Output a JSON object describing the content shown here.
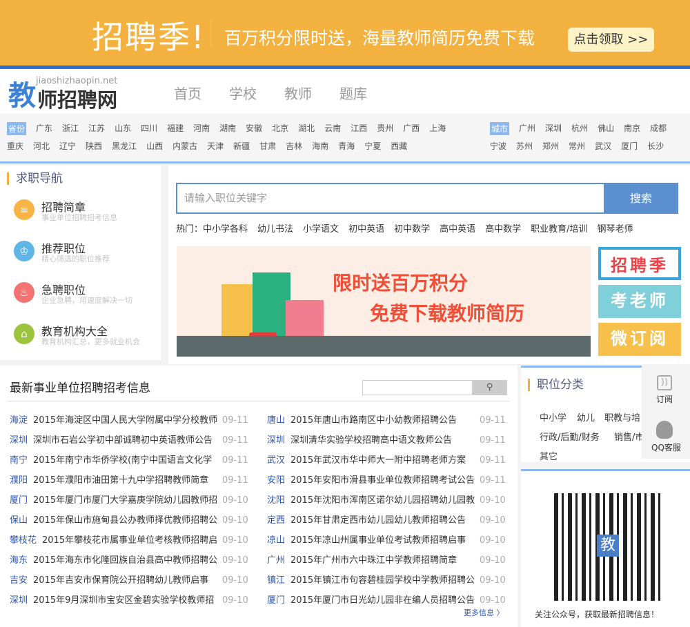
{
  "banner": {
    "big": "招聘季!",
    "slogan": "百万积分限时送，海量教师简历免费下载",
    "button": "点击领取 >>"
  },
  "logo": {
    "char": "教",
    "url": "jiaoshizhaopin.net",
    "name": "师招聘网"
  },
  "nav": [
    "首页",
    "学校",
    "教师",
    "题库"
  ],
  "area": {
    "province_tag": "省份",
    "provinces_row1": [
      "广东",
      "浙江",
      "江苏",
      "山东",
      "四川",
      "福建",
      "河南",
      "湖南",
      "安徽",
      "北京",
      "湖北",
      "云南",
      "江西",
      "贵州",
      "广西",
      "上海"
    ],
    "provinces_row2": [
      "重庆",
      "河北",
      "辽宁",
      "陕西",
      "黑龙江",
      "山西",
      "内蒙古",
      "天津",
      "新疆",
      "甘肃",
      "吉林",
      "海南",
      "青海",
      "宁夏",
      "西藏"
    ],
    "city_tag": "城市",
    "cities_row1": [
      "广州",
      "深圳",
      "杭州",
      "佛山",
      "南京",
      "成都"
    ],
    "cities_row2": [
      "宁波",
      "苏州",
      "郑州",
      "常州",
      "武汉",
      "厦门",
      "长沙"
    ]
  },
  "sidebar": {
    "title": "求职导航",
    "items": [
      {
        "title": "招聘简章",
        "sub": "事业单位招聘招考信息",
        "color": "#f7b445",
        "icon": "≡"
      },
      {
        "title": "推荐职位",
        "sub": "精心筛选的职位推荐",
        "color": "#5fb5e6",
        "icon": "♔"
      },
      {
        "title": "急聘职位",
        "sub": "企业急聘，用速度解决一切",
        "color": "#f47272",
        "icon": "♨"
      },
      {
        "title": "教育机构大全",
        "sub": "教育机构汇总，更多就业机会",
        "color": "#9cc43d",
        "icon": "⌂"
      }
    ]
  },
  "search": {
    "placeholder": "请输入职位关键字",
    "button": "搜索"
  },
  "hot": {
    "label": "热门：",
    "items": [
      "中小学各科",
      "幼儿书法",
      "小学语文",
      "初中英语",
      "初中数学",
      "高中英语",
      "高中数学",
      "职业教育/培训",
      "钢琴老师"
    ]
  },
  "ad": {
    "line1": "限时送百万积分",
    "line2": "免费下载教师简历"
  },
  "side_buttons": [
    "招聘季",
    "考老师",
    "微订阅"
  ],
  "list": {
    "title": "最新事业单位招聘招考信息",
    "more": "更多信息 〉",
    "left": [
      [
        "海淀",
        "2015年海淀区中国人民大学附属中学分校教师",
        "09-11"
      ],
      [
        "深圳",
        "深圳市石岩公学初中部诚聘初中英语教师公告",
        "09-11"
      ],
      [
        "南宁",
        "2015年南宁市华侨学校(南宁中国语言文化学",
        "09-11"
      ],
      [
        "濮阳",
        "2015年濮阳市油田第十九中学招聘教师简章",
        "09-11"
      ],
      [
        "厦门",
        "2015年厦门市厦门大学嘉庚学院幼儿园教师招",
        "09-10"
      ],
      [
        "保山",
        "2015年保山市施甸县公办教师择优教师招聘公",
        "09-10"
      ],
      [
        "攀枝花",
        "2015年攀枝花市属事业单位考核教师招聘启",
        "09-10"
      ],
      [
        "海东",
        "2015年海东市化隆回族自治县高中教师招聘公",
        "09-10"
      ],
      [
        "吉安",
        "2015年吉安市保育院公开招聘幼儿教师启事",
        "09-10"
      ],
      [
        "深圳",
        "2015年9月深圳市宝安区金碧实验学校教师招",
        "09-10"
      ]
    ],
    "right": [
      [
        "唐山",
        "2015年唐山市路南区中小幼教师招聘公告",
        "09-11"
      ],
      [
        "深圳",
        "深圳清华实验学校招聘高中语文教师公告",
        "09-11"
      ],
      [
        "武汉",
        "2015年武汉市华中师大一附中招聘老师方案",
        "09-11"
      ],
      [
        "安阳",
        "2015年安阳市滑县事业单位教师招聘考试公告",
        "09-11"
      ],
      [
        "沈阳",
        "2015年沈阳市浑南区诺尔幼儿园招聘幼儿园教",
        "09-10"
      ],
      [
        "定西",
        "2015年甘肃定西市幼儿园幼儿教师招聘公告",
        "09-10"
      ],
      [
        "凉山",
        "2015年凉山州属事业单位考试教师招聘启事",
        "09-10"
      ],
      [
        "广州",
        "2015年广州市六中珠江中学教师招聘简章",
        "09-10"
      ],
      [
        "镇江",
        "2015年镇江市句容碧桂园学校中学教师招聘公",
        "09-10"
      ],
      [
        "厦门",
        "2015年厦门市日光幼儿园非在编人员招聘公告",
        "09-10"
      ]
    ]
  },
  "category": {
    "title": "职位分类",
    "items": [
      "中小学",
      "幼儿",
      "职教与培",
      "行政/后勤/财务",
      "销售/市",
      "其它"
    ]
  },
  "float": {
    "subscribe": "订阅",
    "qq": "QQ客服"
  },
  "qr": {
    "caption": "关注公众号，获取最新招聘信息！",
    "logo_char": "教"
  }
}
